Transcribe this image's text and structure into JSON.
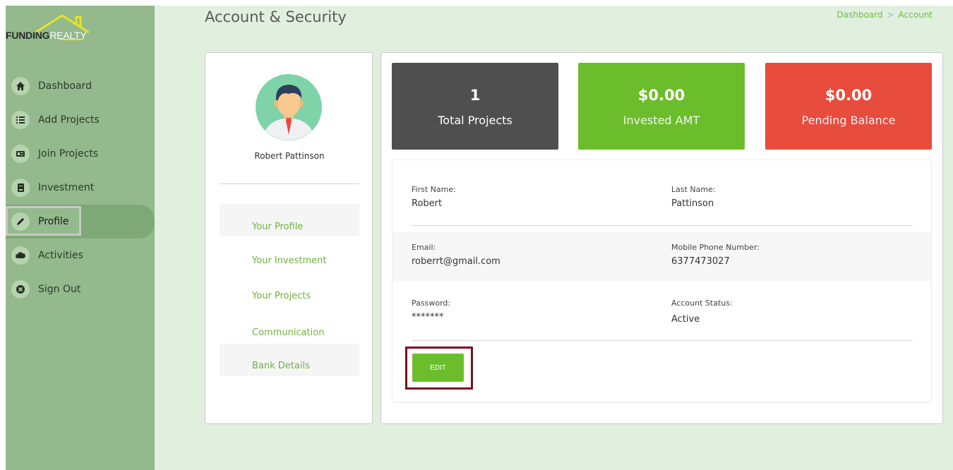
{
  "brand": {
    "word1": "FUNDING",
    "word2": "REALTY"
  },
  "sidebar": {
    "items": [
      {
        "label": "Dashboard",
        "icon": "home-icon"
      },
      {
        "label": "Add Projects",
        "icon": "list-icon"
      },
      {
        "label": "Join Projects",
        "icon": "id-card-icon"
      },
      {
        "label": "Investment",
        "icon": "book-icon"
      },
      {
        "label": "Profile",
        "icon": "pencil-icon",
        "active": true
      },
      {
        "label": "Activities",
        "icon": "cloud-icon"
      },
      {
        "label": "Sign Out",
        "icon": "close-circle-icon"
      }
    ]
  },
  "header": {
    "title": "Account & Security",
    "breadcrumb": [
      "Dashboard",
      "Account"
    ],
    "breadcrumb_sep": ">"
  },
  "profile": {
    "name": "Robert Pattinson",
    "menu": [
      "Your Profile",
      "Your Investment",
      "Your Projects",
      "Communication",
      "Bank Details"
    ]
  },
  "stats": [
    {
      "value": "1",
      "label": "Total Projects",
      "color": "#4f4f4f"
    },
    {
      "value": "$0.00",
      "label": "Invested AMT",
      "color": "#6cbd2c"
    },
    {
      "value": "$0.00",
      "label": "Pending Balance",
      "color": "#e84c3d"
    }
  ],
  "details": {
    "first_name_label": "First Name:",
    "first_name": "Robert",
    "last_name_label": "Last Name:",
    "last_name": "Pattinson",
    "email_label": "Email:",
    "email": "roberrt@gmail.com",
    "phone_label": "Mobile Phone Number:",
    "phone": "6377473027",
    "password_label": "Password:",
    "password": "*******",
    "status_label": "Account Status:",
    "status": "Active",
    "edit_label": "EDIT"
  },
  "colors": {
    "sidebar_bg": "#93b98c",
    "main_bg": "#e1efdf",
    "accent_green": "#6cbd2c",
    "highlight_border": "#7a1023"
  }
}
